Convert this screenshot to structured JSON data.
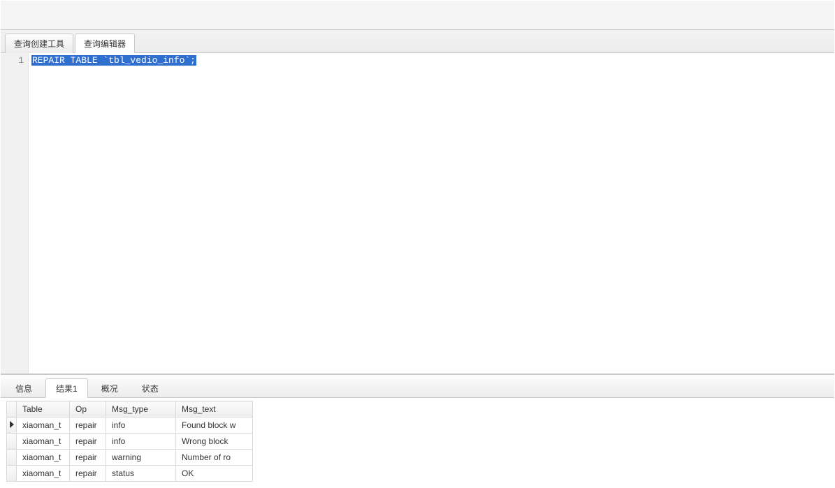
{
  "tabs": {
    "editor": [
      {
        "label": "查询创建工具",
        "active": false
      },
      {
        "label": "查询编辑器",
        "active": true
      }
    ],
    "bottom": [
      {
        "label": "信息",
        "active": false
      },
      {
        "label": "结果1",
        "active": true
      },
      {
        "label": "概况",
        "active": false
      },
      {
        "label": "状态",
        "active": false
      }
    ]
  },
  "editor": {
    "line_number": "1",
    "code_selected": "REPAIR TABLE `tbl_vedio_info`;"
  },
  "results": {
    "columns": [
      "Table",
      "Op",
      "Msg_type",
      "Msg_text"
    ],
    "rows": [
      {
        "current": true,
        "cells": [
          "xiaoman_t",
          "repair",
          "info",
          "Found block w"
        ]
      },
      {
        "current": false,
        "cells": [
          "xiaoman_t",
          "repair",
          "info",
          "Wrong block"
        ]
      },
      {
        "current": false,
        "cells": [
          "xiaoman_t",
          "repair",
          "warning",
          "Number of ro"
        ]
      },
      {
        "current": false,
        "cells": [
          "xiaoman_t",
          "repair",
          "status",
          "OK"
        ]
      }
    ]
  }
}
